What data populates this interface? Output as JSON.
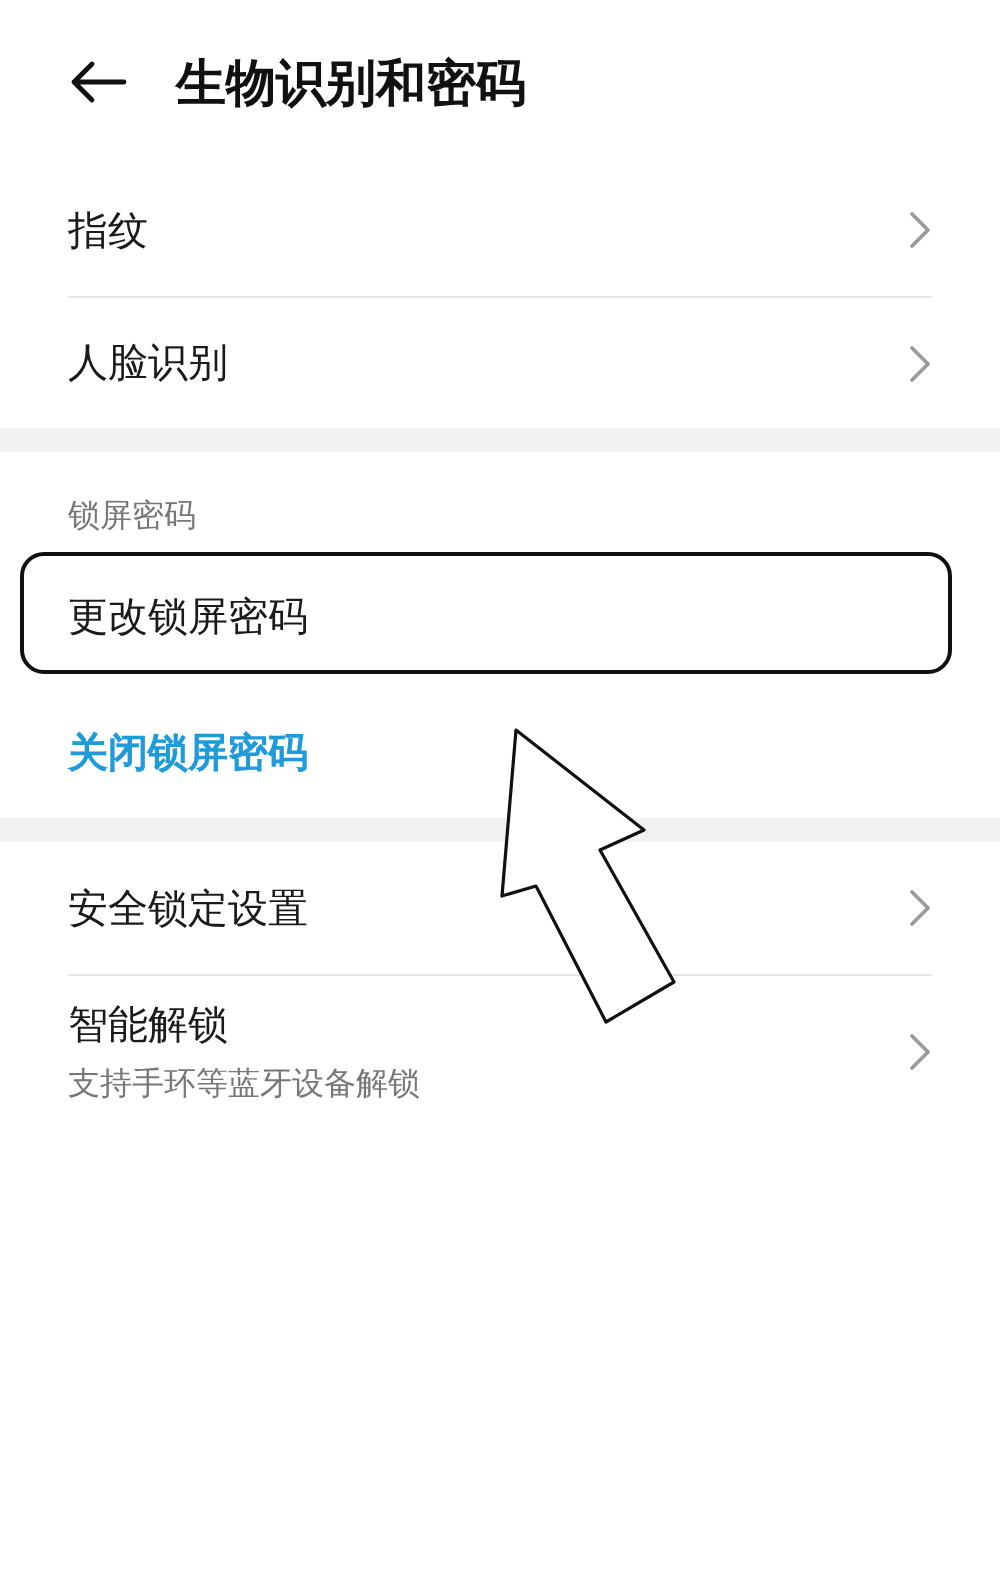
{
  "header": {
    "title": "生物识别和密码"
  },
  "groups": [
    {
      "items": [
        {
          "kind": "nav",
          "label": "指纹"
        },
        {
          "kind": "nav",
          "label": "人脸识别"
        }
      ]
    },
    {
      "section_label": "锁屏密码",
      "items": [
        {
          "kind": "plain",
          "label": "更改锁屏密码",
          "highlighted": true
        },
        {
          "kind": "action",
          "label": "关闭锁屏密码"
        }
      ]
    },
    {
      "items": [
        {
          "kind": "nav",
          "label": "安全锁定设置"
        },
        {
          "kind": "nav",
          "label": "智能解锁",
          "subtitle": "支持手环等蓝牙设备解锁"
        }
      ]
    }
  ],
  "annotation": {
    "kind": "arrow"
  }
}
